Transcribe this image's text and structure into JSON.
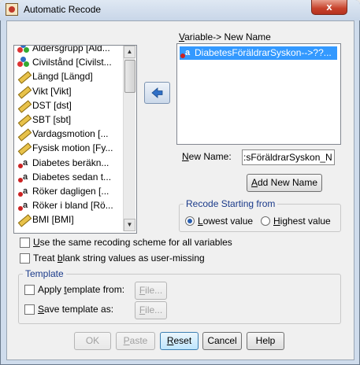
{
  "window": {
    "title": "Automatic Recode",
    "close_label": "x"
  },
  "source_list": {
    "items": [
      {
        "label": "Åldersgrupp [Åld...",
        "icon": "nominal-icon"
      },
      {
        "label": "Civilstånd [Civilst...",
        "icon": "nominal-icon"
      },
      {
        "label": "Längd [Längd]",
        "icon": "scale-icon"
      },
      {
        "label": "Vikt [Vikt]",
        "icon": "scale-icon"
      },
      {
        "label": "DST [dst]",
        "icon": "scale-icon"
      },
      {
        "label": "SBT [sbt]",
        "icon": "scale-icon"
      },
      {
        "label": "Vardagsmotion [...",
        "icon": "scale-icon"
      },
      {
        "label": "Fysisk motion [Fy...",
        "icon": "scale-icon"
      },
      {
        "label": "Diabetes beräkn...",
        "icon": "string-icon"
      },
      {
        "label": "Diabetes sedan t...",
        "icon": "string-icon"
      },
      {
        "label": "Röker dagligen [...",
        "icon": "string-icon"
      },
      {
        "label": "Röker i bland [Rö...",
        "icon": "string-icon"
      },
      {
        "label": "BMI [BMI]",
        "icon": "scale-icon"
      }
    ]
  },
  "variable_box": {
    "label_prefix": "V",
    "label_rest": "ariable-> New Name",
    "selected_item": "DiabetesFöräldrarSyskon-->??..."
  },
  "new_name": {
    "label_prefix": "N",
    "label_rest": "ew Name:",
    "value": ":sFöräldrarSyskon_N",
    "add_button_prefix": "A",
    "add_button_rest": "dd New Name"
  },
  "recode_group": {
    "title": "Recode Starting from",
    "lowest_prefix": "L",
    "lowest_rest": "owest value",
    "highest_prefix": "H",
    "highest_rest": "ighest value",
    "selected": "lowest"
  },
  "options": {
    "same_scheme_prefix": "U",
    "same_scheme_rest": "se the same recoding scheme for all variables",
    "blank_part1": "Treat ",
    "blank_ul": "b",
    "blank_part2": "lank string values as user-missing"
  },
  "template_group": {
    "title": "Template",
    "apply_part1": "Apply ",
    "apply_ul": "t",
    "apply_part2": "emplate from:",
    "save_prefix": "S",
    "save_rest": "ave template as:",
    "file_prefix": "F",
    "file_rest": "ile..."
  },
  "buttons": {
    "ok": "OK",
    "paste_prefix": "P",
    "paste_rest": "aste",
    "reset_prefix": "R",
    "reset_rest": "eset",
    "cancel": "Cancel",
    "help": "Help"
  },
  "colors": {
    "selection": "#3399ff",
    "close_button": "#c7422b",
    "group_title": "#1a3a8a"
  }
}
